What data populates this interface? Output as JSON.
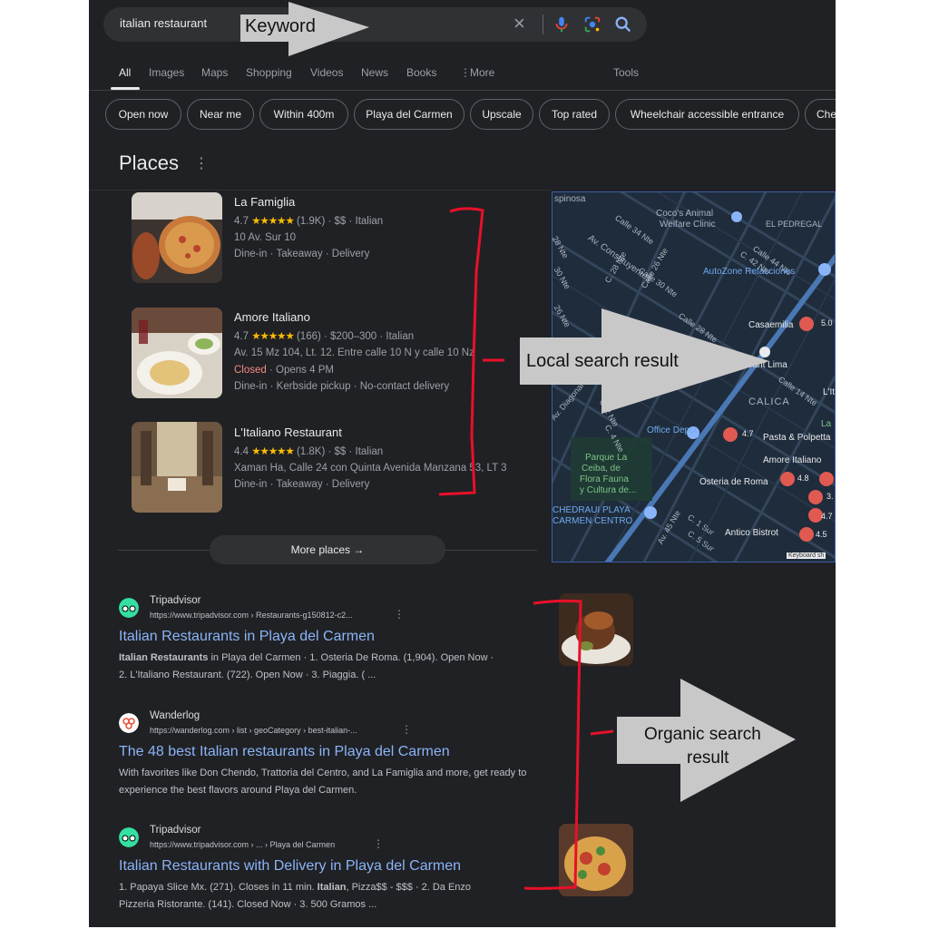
{
  "search": {
    "query": "italian restaurant"
  },
  "tabs": [
    "All",
    "Images",
    "Maps",
    "Shopping",
    "Videos",
    "News",
    "Books",
    "More"
  ],
  "tools_label": "Tools",
  "chips": [
    "Open now",
    "Near me",
    "Within 400m",
    "Playa del Carmen",
    "Upscale",
    "Top rated",
    "Wheelchair accessible entrance",
    "Che"
  ],
  "places": {
    "title": "Places",
    "items": [
      {
        "name": "La Famiglia",
        "rating": "4.7",
        "stars": "★★★★★",
        "meta": "(1.9K) · $$ · Italian",
        "address": "10 Av. Sur 10",
        "services": "Dine-in · Takeaway · Delivery"
      },
      {
        "name": "Amore Italiano",
        "rating": "4.7",
        "stars": "★★★★★",
        "meta": "(166) · $200–300 · Italian",
        "address": "Av. 15 Mz 104, Lt. 12. Entre calle 10 N y calle 10 Nz",
        "status": "Closed",
        "hours": "· Opens 4 PM",
        "services": "Dine-in · Kerbside pickup · No-contact delivery"
      },
      {
        "name": "L'Italiano Restaurant",
        "rating": "4.4",
        "stars": "★★★★★",
        "meta": "(1.8K) · $$ · Italian",
        "address": "Xaman Ha, Calle 24 con Quinta Avenida Manzana 53, LT 3",
        "services": "Dine-in · Takeaway · Delivery"
      }
    ],
    "more_label": "More places"
  },
  "map": {
    "labels": [
      "spinosa",
      "Coco's Animal",
      "Welfare Clinic",
      "EL PEDREGAL",
      "Av. Constituyentes",
      "Calle 34 Nte",
      "Calle 44 Nte",
      "C. 42 Nte",
      "AutoZone Refacciones",
      "Calle 30 Nte",
      "C. 28 Nte",
      "Casaemilia",
      "5.0",
      "Calle 28 Nte",
      "aurant Lima",
      "CALICA",
      "Calle 14 Nte",
      "Av. Diagonal",
      "Office Depot",
      "4.7",
      "Pasta & Polpetta",
      "La",
      "Amore Italiano",
      "4.8",
      "Osteria de Roma",
      "Parque La",
      "Ceiba, de",
      "Flora Fauna",
      "y Cultura de...",
      "CHEDRAUI PLAYA",
      "CARMEN CENTRO",
      "Av. 45 Nte",
      "C. 1 Sur",
      "C. 5 Sur",
      "Antico Bistrot",
      "4.7",
      "4.5",
      "3.",
      "Keyboard sh",
      "28 Nte",
      "30 Nte",
      "26 Nte",
      "Calle 26 Nte",
      "16 Nte",
      "L'It",
      "C. 4 Nte",
      "C. 2 Nte"
    ]
  },
  "results": [
    {
      "site": "Tripadvisor",
      "url": "https://www.tripadvisor.com › Restaurants-g150812-c2...",
      "title": "Italian Restaurants in Playa del Carmen",
      "snippet_bold": "Italian Restaurants",
      "snippet_1": " in Playa del Carmen · 1. Osteria De Roma. (1,904). Open Now ·",
      "snippet_2": "2. L'Italiano Restaurant. (722). Open Now · 3. Piaggia. ( ..."
    },
    {
      "site": "Wanderlog",
      "url": "https://wanderlog.com › list › geoCategory › best-italian-...",
      "title": "The 48 best Italian restaurants in Playa del Carmen",
      "snippet_1": "With favorites like Don Chendo, Trattoria del Centro, and La Famiglia and more, get ready to",
      "snippet_2": "experience the best flavors around Playa del Carmen."
    },
    {
      "site": "Tripadvisor",
      "url": "https://www.tripadvisor.com › ... › Playa del Carmen",
      "title": "Italian Restaurants with Delivery in Playa del Carmen",
      "snippet_1a": "1. Papaya Slice Mx. (271). Closes in 11 min. ",
      "snippet_bold": "Italian",
      "snippet_1b": ", Pizza$$ - $$$ · 2. Da Enzo",
      "snippet_2": "Pizzeria Ristorante. (141). Closed Now · 3. 500 Gramos ..."
    }
  ],
  "annotations": {
    "keyword": "Keyword",
    "local": "Local search result",
    "organic_1": "Organic search",
    "organic_2": "result"
  },
  "colors": {
    "background": "#202124",
    "link": "#8ab4f8",
    "star": "#fbbc04",
    "annotation_line": "#e8102a",
    "arrow": "#c8c8c8"
  }
}
